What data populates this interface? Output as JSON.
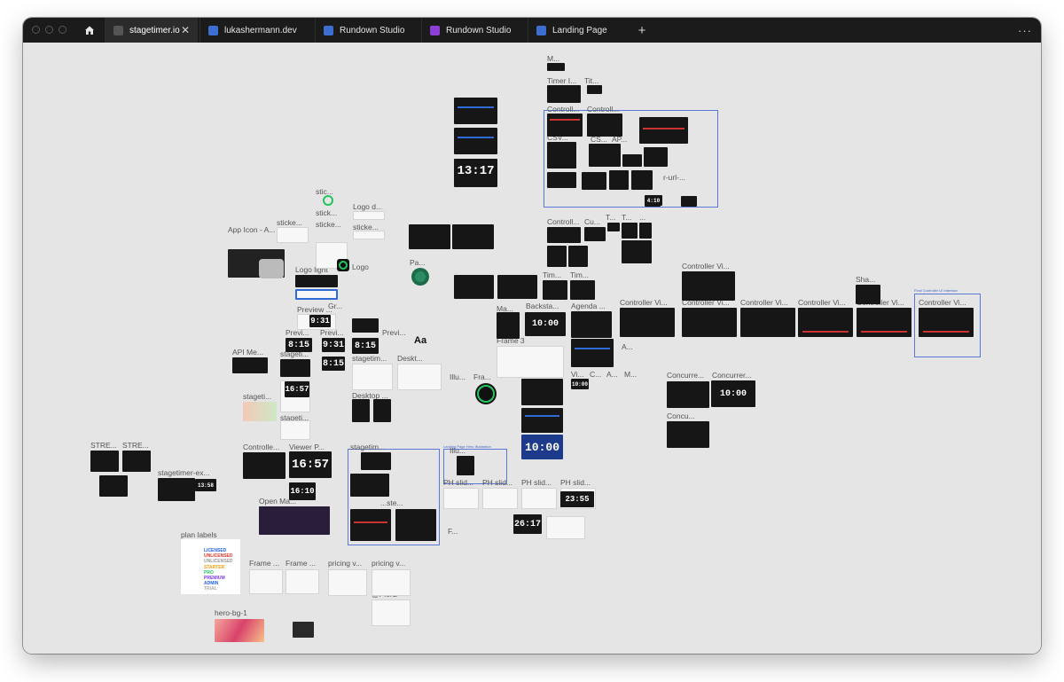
{
  "tabs": [
    {
      "label": "stagetimer.io",
      "close_label": "✕"
    },
    {
      "label": "lukashermann.dev"
    },
    {
      "label": "Rundown Studio"
    },
    {
      "label": "Rundown Studio"
    },
    {
      "label": "Landing Page"
    }
  ],
  "new_tab_label": "+",
  "menu_label": "···",
  "colors": {
    "accent": "#2e6bd6",
    "selection": "#5a78d6",
    "brand_green": "#22c55e",
    "canvas": "#e5e5e5"
  },
  "labels": {
    "m_top": "M...",
    "timer_i": "Timer I...",
    "tit": "Tit...",
    "controll_a": "Controll...",
    "controll_b": "Controll...",
    "csv": "CSV...",
    "cs": "CS...",
    "ap": "AP...",
    "url": "r-url-...",
    "stic": "stic...",
    "sticke_a": "sticke...",
    "stick": "stick...",
    "sticke_b": "sticke...",
    "logo_d": "Logo d...",
    "sticke_c": "sticke...",
    "logo": "Logo",
    "logo_light": "Logo light",
    "app_icon": "App Icon - A...",
    "pa": "Pa...",
    "controll_c": "Controll...",
    "cu": "Cu...",
    "t1": "T...",
    "t2": "T...",
    "dots": "...",
    "controller_vi_a": "Controller Vi...",
    "controller_vi_b": "Controller Vi...",
    "controller_vi_c": "Controller Vi...",
    "controller_vi_d": "Controller Vi...",
    "controller_vi_e": "Controller Vi...",
    "controller_vi_f": "Controller Vi...",
    "controller_vi_g": "Controller Vi...",
    "sha": "Sha...",
    "final_ctrl": "Final Controller UI Interface",
    "tim1": "Tim...",
    "tim2": "Tim...",
    "ma": "Ma...",
    "backsta": "Backsta...",
    "agenda": "Agenda ...",
    "preview": "Preview ...",
    "gr": "Gr...",
    "previ_a": "Previ...",
    "previ_b": "Previ...",
    "previ_c": "Previ...",
    "api": "API Me...",
    "stageti_a": "stageti...",
    "stagetim": "stagetim...",
    "deskt": "Deskt...",
    "desktop": "Desktop ...",
    "stageti_b": "stageti...",
    "stageti_c": "stageti...",
    "frame3": "Frame 3",
    "illu_a": "Illu...",
    "fra": "Fra...",
    "a": "A...",
    "vi": "Vi...",
    "c": "C...",
    "a2": "A...",
    "m": "M...",
    "concurre": "Concurre...",
    "concurrer": "Concurrer...",
    "concu": "Concu...",
    "streams_a": "STRE...",
    "streams_b": "STRE...",
    "controlle": "Controlle...",
    "viewer": "Viewer P...",
    "stagetimer_ex": "stagetimer-ex...",
    "stagetim2": "stagetim...",
    "ste": "...ste...",
    "landing_hero": "Landing Page Hero Illustration",
    "illu_b": "Illu...",
    "open_ma": "Open Ma...",
    "ph1": "PH slid...",
    "ph2": "PH slid...",
    "ph3": "PH slid...",
    "ph4": "PH slid...",
    "plan_labels": "plan labels",
    "frame_a": "Frame ...",
    "frame_b": "Frame ...",
    "pricing_a": "pricing v...",
    "pricing_b": "pricing v...",
    "pierb": "@PierB",
    "hero_bg": "hero-bg-1",
    "f": "F...",
    "aa": "Aa"
  },
  "plans": [
    "LICENSED",
    "UNLICENSED",
    "UNLICENSED",
    "STARTER",
    "PRO",
    "PREMIUM",
    "ADMIN",
    "TRIAL"
  ],
  "clocks": {
    "c1": "13:17",
    "c2": "10:00",
    "c3": "9:31",
    "c4": "8:15",
    "c5": "9:31",
    "c6": "8:15",
    "c7": "8:15",
    "c8": "16:57",
    "c9": "16:57",
    "c10": "16:10",
    "c11": "10:00",
    "c12": "10:00",
    "c13": "26:17",
    "c14": "23:55",
    "c15": "13:58",
    "c16": "4:10",
    "c17": "10:00"
  }
}
